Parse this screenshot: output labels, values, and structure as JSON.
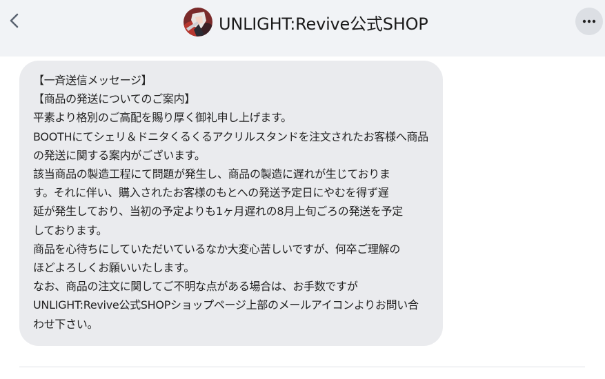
{
  "header": {
    "title": "UNLIGHT:Revive公式SHOP",
    "back_icon": "chevron-left-icon",
    "more_icon": "ellipsis-icon"
  },
  "message": {
    "lines": [
      "【一斉送信メッセージ】",
      "【商品の発送についてのご案内】",
      "平素より格別のご高配を賜り厚く御礼申し上げます。",
      "BOOTHにてシェリ＆ドニタくるくるアクリルスタンドを注文されたお客様へ商品",
      "の発送に関する案内がございます。",
      "該当商品の製造工程にて問題が発生し、商品の製造に遅れが生じておりま",
      "す。それに伴い、購入されたお客様のもとへの発送予定日にやむを得ず遅",
      "延が発生しており、当初の予定よりも1ヶ月遅れの8月上旬ごろの発送を予定",
      "しております。",
      "商品を心待ちにしていただいているなか大変心苦しいですが、何卒ご理解の",
      "ほどよろしくお願いいたします。",
      "なお、商品の注文に関してご不明な点がある場合は、お手数ですが",
      "UNLIGHT:Revive公式SHOPショップページ上部のメールアイコンよりお問い合",
      "わせ下さい。"
    ]
  }
}
